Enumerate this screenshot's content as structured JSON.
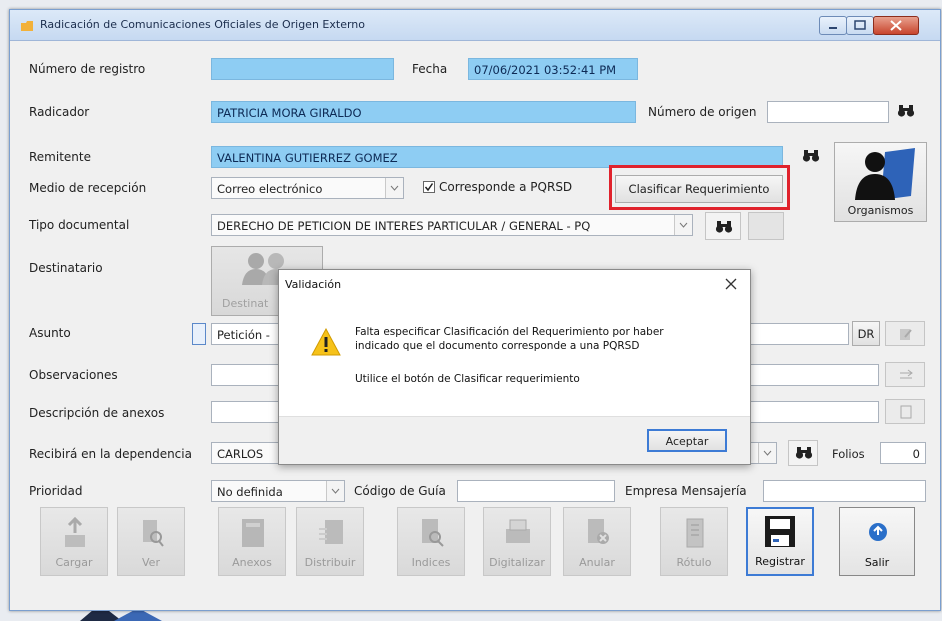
{
  "window": {
    "title": "Radicación de Comunicaciones Oficiales de Origen Externo"
  },
  "form": {
    "numero_registro_label": "Número de registro",
    "numero_registro_value": "",
    "fecha_label": "Fecha",
    "fecha_value": "07/06/2021 03:52:41 PM",
    "radicador_label": "Radicador",
    "radicador_value": "PATRICIA MORA GIRALDO",
    "numero_origen_label": "Número de origen",
    "numero_origen_value": "",
    "remitente_label": "Remitente",
    "remitente_value": "VALENTINA GUTIERREZ GOMEZ",
    "medio_label": "Medio de recepción",
    "medio_value": "Correo electrónico",
    "pqrsd_label": "Corresponde a PQRSD",
    "pqrsd_checked": true,
    "clasificar_button": "Clasificar Requerimiento",
    "organismos_label": "Organismos",
    "tipo_label": "Tipo documental",
    "tipo_value": "DERECHO DE PETICION DE INTERES PARTICULAR / GENERAL - PQ",
    "destinatario_label": "Destinatario",
    "destinatario_button": "Destinat",
    "asunto_label": "Asunto",
    "asunto_value": "Petición -",
    "dr_button": "DR",
    "observaciones_label": "Observaciones",
    "anexos_label": "Descripción de anexos",
    "recibira_label": "Recibirá en la dependencia",
    "recibira_value": "CARLOS",
    "folios_label": "Folios",
    "folios_value": "0",
    "prioridad_label": "Prioridad",
    "prioridad_value": "No definida",
    "codigo_guia_label": "Código de Guía",
    "empresa_label": "Empresa Mensajería"
  },
  "toolbar": {
    "buttons": [
      "Cargar",
      "Ver",
      "Anexos",
      "Distribuir",
      "Indices",
      "Digitalizar",
      "Anular",
      "Rótulo",
      "Registrar",
      "Salir"
    ]
  },
  "dialog": {
    "title": "Validación",
    "message_line1": "Falta especificar Clasificación del Requerimiento por haber",
    "message_line2": "indicado que el documento corresponde a una PQRSD",
    "message_line3": "Utilice el botón de Clasificar requerimiento",
    "ok_button": "Aceptar"
  },
  "colors": {
    "field_highlight": "#8ecdf3",
    "annotation_box": "#e0222c",
    "dialog_default_button": "#3d7bd5"
  }
}
